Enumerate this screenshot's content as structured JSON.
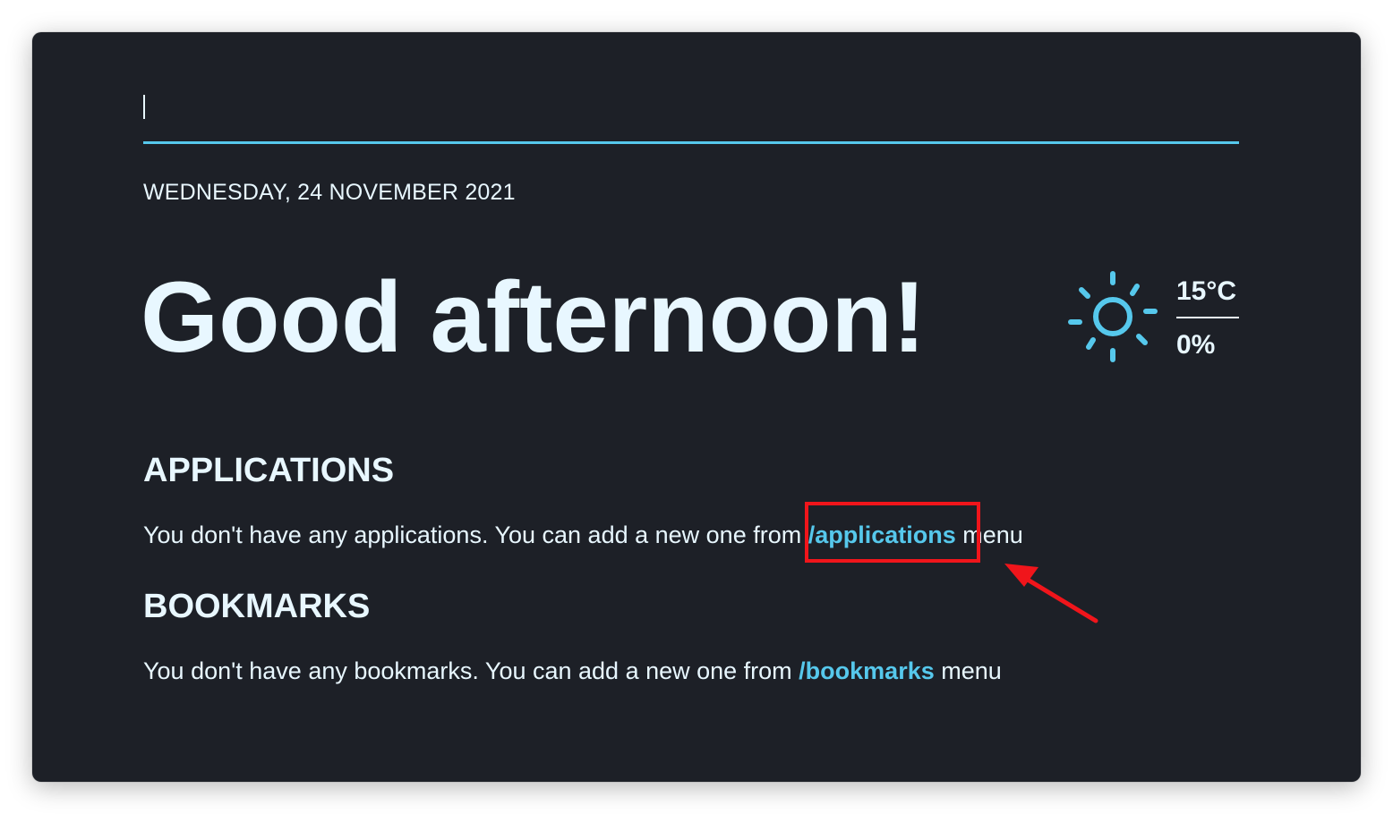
{
  "search": {
    "value": "",
    "accent_color": "#56c8ec"
  },
  "header": {
    "date": "WEDNESDAY, 24 NOVEMBER 2021",
    "greeting": "Good afternoon!"
  },
  "weather": {
    "icon": "sun-icon",
    "temperature": "15°C",
    "precipitation": "0%"
  },
  "applications": {
    "title": "APPLICATIONS",
    "empty_text": "You don't have any applications. You can add a new one from ",
    "link_label": "/applications",
    "suffix": " menu"
  },
  "bookmarks": {
    "title": "BOOKMARKS",
    "empty_text": "You don't have any bookmarks. You can add a new one from ",
    "link_label": "/bookmarks",
    "suffix": " menu"
  },
  "annotation": {
    "box_color": "#f0151b",
    "arrow_icon": "red-arrow-icon"
  },
  "colors": {
    "background": "#1d2027",
    "text": "#e8f7ff",
    "accent": "#56c8ec"
  }
}
